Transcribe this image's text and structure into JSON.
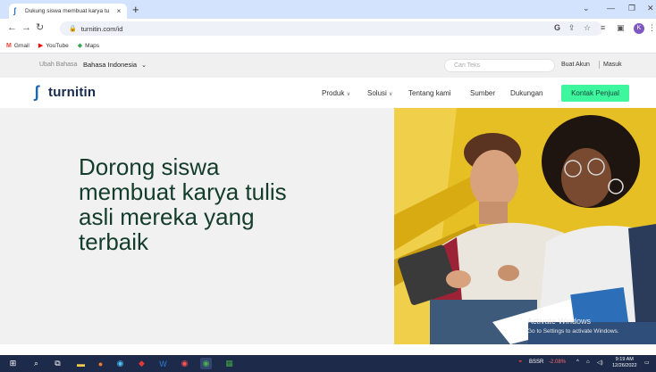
{
  "browser": {
    "tab_title": "Dukung siswa membuat karya tu",
    "tab_close": "×",
    "new_tab": "+",
    "url": "turnitin.com/id",
    "bookmarks": [
      {
        "label": "Gmail",
        "icon": "gmail-icon",
        "color": "#ea4335"
      },
      {
        "label": "YouTube",
        "icon": "youtube-icon",
        "color": "#ff0000"
      },
      {
        "label": "Maps",
        "icon": "maps-icon",
        "color": "#34a853"
      }
    ],
    "profile_initial": "K"
  },
  "utility": {
    "lang_label": "Ubah Bahasa",
    "lang_value": "Bahasa Indonesia",
    "search_placeholder": "Cari Teks",
    "create_account": "Buat Akun",
    "login": "Masuk"
  },
  "nav": {
    "logo_text": "turnitin",
    "items": [
      "Produk",
      "Solusi",
      "Tentang kami",
      "Sumber",
      "Dukungan"
    ],
    "cta": "Kontak Penjual"
  },
  "hero": {
    "headline_lines": [
      "Dorong siswa",
      "membuat karya tulis",
      "asli mereka yang",
      "terbaik"
    ]
  },
  "watermark": {
    "title": "Activate Windows",
    "subtitle": "Go to Settings to activate Windows."
  },
  "taskbar": {
    "ticker": "BSSR",
    "ticker_change": "-2.08%",
    "time": "9:19 AM",
    "date": "12/26/2022"
  },
  "colors": {
    "tab_strip": "#d3e3fd",
    "brand_navy": "#16294f",
    "brand_blue": "#1a69b3",
    "cta_green": "#3df69d",
    "headline": "#143c2c",
    "hero_bg": "#f1f1f1",
    "photo_yellow": "#e8c12a",
    "taskbar": "#1d2a4a"
  }
}
